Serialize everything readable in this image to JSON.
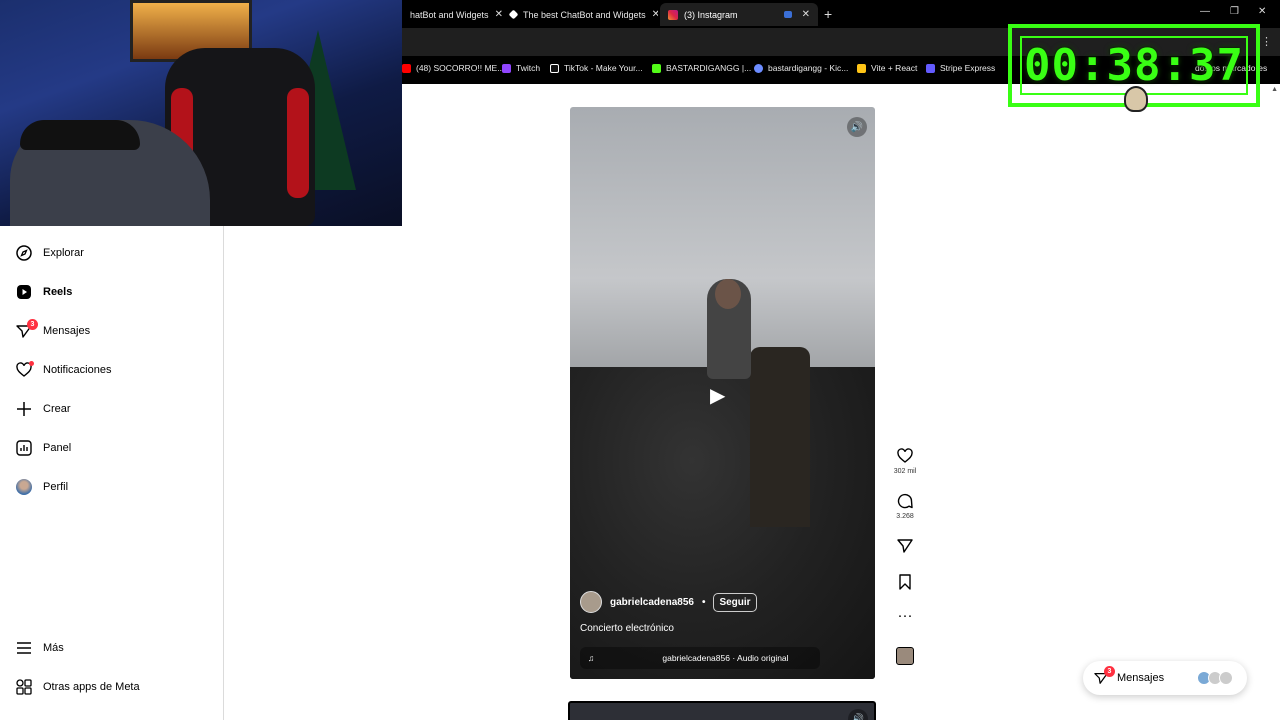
{
  "browser": {
    "tabs": [
      {
        "title": "hatBot and Widgets"
      },
      {
        "title": "The best ChatBot and Widgets"
      },
      {
        "title": "(3) Instagram"
      }
    ],
    "new_tab": "+",
    "bookmarks": [
      {
        "label": "(48) SOCORRO!! ME...",
        "color": "#ff0000"
      },
      {
        "label": "Twitch",
        "color": "#9146ff"
      },
      {
        "label": "TikTok - Make Your...",
        "color": "#ffffff"
      },
      {
        "label": "BASTARDIGANGG |...",
        "color": "#53fc18"
      },
      {
        "label": "bastardigangg - Kic...",
        "color": "#6c8cff"
      },
      {
        "label": "Vite + React",
        "color": "#ffc517"
      },
      {
        "label": "Stripe Express",
        "color": "#635bff"
      },
      {
        "label": "dos os marcadores",
        "color": "#dddddd"
      }
    ]
  },
  "timer": {
    "value": "00:38:37"
  },
  "sidebar": {
    "items": [
      {
        "label": "Explorar",
        "icon": "compass-icon"
      },
      {
        "label": "Reels",
        "icon": "reels-icon"
      },
      {
        "label": "Mensajes",
        "icon": "messenger-icon",
        "badge": "3"
      },
      {
        "label": "Notificaciones",
        "icon": "heart-icon"
      },
      {
        "label": "Crear",
        "icon": "plus-icon"
      },
      {
        "label": "Panel",
        "icon": "chart-icon"
      },
      {
        "label": "Perfil",
        "icon": "avatar"
      }
    ],
    "bottom": [
      {
        "label": "Más",
        "icon": "hamburger-icon"
      },
      {
        "label": "Otras apps de Meta",
        "icon": "grid-icon"
      }
    ]
  },
  "reel": {
    "username": "gabrielcadena856",
    "separator": "•",
    "follow_label": "Seguir",
    "caption": "Concierto electrónico",
    "audio": "gabrielcadena856 · Audio original",
    "likes": "302 mil",
    "comments": "3.268"
  },
  "messages_pill": {
    "label": "Mensajes",
    "badge": "3"
  },
  "colors": {
    "accent_red": "#ff3040",
    "timer_green": "#39ff14"
  }
}
